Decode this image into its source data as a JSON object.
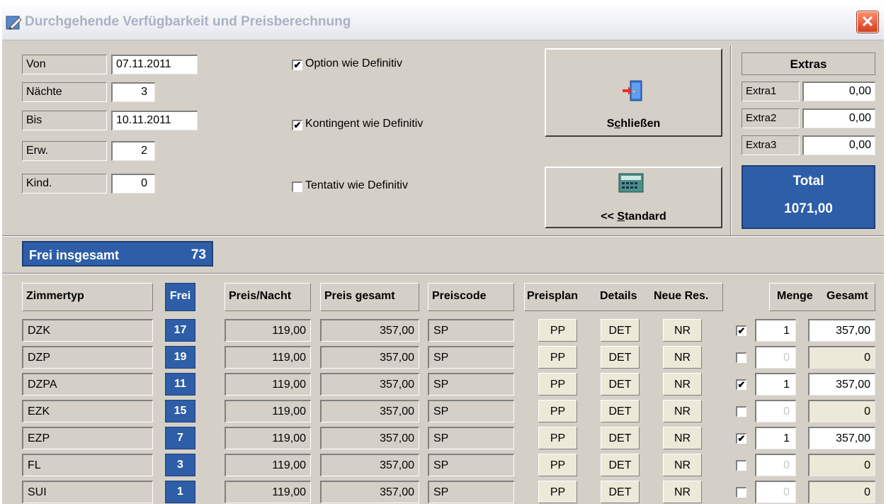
{
  "window": {
    "title": "Durchgehende Verfügbarkeit und Preisberechnung",
    "close_glyph": "✕"
  },
  "form": {
    "von_label": "Von",
    "von_value": "07.11.2011",
    "naechte_label": "Nächte",
    "naechte_value": "3",
    "bis_label": "Bis",
    "bis_value": "10.11.2011",
    "erw_label": "Erw.",
    "erw_value": "2",
    "kind_label": "Kind.",
    "kind_value": "0"
  },
  "options": [
    {
      "label": "Option wie Definitiv",
      "checked": true,
      "mark": "✔"
    },
    {
      "label": "Kontingent wie Definitiv",
      "checked": true,
      "mark": "✔"
    },
    {
      "label": "Tentativ wie Definitiv",
      "checked": false,
      "mark": ""
    }
  ],
  "buttons": {
    "close_prefix": "S",
    "close_mnemonic": "c",
    "close_suffix": "hließen",
    "standard_prefix": "<< ",
    "standard_mnemonic": "S",
    "standard_suffix": "tandard"
  },
  "icons": {
    "close": "door-exit-icon",
    "standard": "calculator-icon",
    "title": "pencil-icon"
  },
  "extras": {
    "header": "Extras",
    "items": [
      {
        "label": "Extra1",
        "value": "0,00"
      },
      {
        "label": "Extra2",
        "value": "0,00"
      },
      {
        "label": "Extra3",
        "value": "0,00"
      }
    ],
    "total_label": "Total",
    "total_value": "1071,00"
  },
  "frei_insgesamt": {
    "label": "Frei insgesamt",
    "value": "73"
  },
  "table": {
    "headers": {
      "zimmertyp": "Zimmertyp",
      "frei": "Frei",
      "preis_nacht": "Preis/Nacht",
      "preis_gesamt": "Preis gesamt",
      "preiscode": "Preiscode",
      "preisplan": "Preisplan",
      "details": "Details",
      "neue_res": "Neue Res.",
      "menge": "Menge",
      "gesamt": "Gesamt"
    },
    "rows": [
      {
        "zimmertyp": "DZK",
        "frei": "17",
        "preis_nacht": "119,00",
        "preis_gesamt": "357,00",
        "preiscode": "SP",
        "pp": "PP",
        "det": "DET",
        "nr": "NR",
        "checked": true,
        "mark": "✔",
        "menge": "1",
        "gesamt": "357,00"
      },
      {
        "zimmertyp": "DZP",
        "frei": "19",
        "preis_nacht": "119,00",
        "preis_gesamt": "357,00",
        "preiscode": "SP",
        "pp": "PP",
        "det": "DET",
        "nr": "NR",
        "checked": false,
        "mark": "",
        "menge": "0",
        "gesamt": "0"
      },
      {
        "zimmertyp": "DZPA",
        "frei": "11",
        "preis_nacht": "119,00",
        "preis_gesamt": "357,00",
        "preiscode": "SP",
        "pp": "PP",
        "det": "DET",
        "nr": "NR",
        "checked": true,
        "mark": "✔",
        "menge": "1",
        "gesamt": "357,00"
      },
      {
        "zimmertyp": "EZK",
        "frei": "15",
        "preis_nacht": "119,00",
        "preis_gesamt": "357,00",
        "preiscode": "SP",
        "pp": "PP",
        "det": "DET",
        "nr": "NR",
        "checked": false,
        "mark": "",
        "menge": "0",
        "gesamt": "0"
      },
      {
        "zimmertyp": "EZP",
        "frei": "7",
        "preis_nacht": "119,00",
        "preis_gesamt": "357,00",
        "preiscode": "SP",
        "pp": "PP",
        "det": "DET",
        "nr": "NR",
        "checked": true,
        "mark": "✔",
        "menge": "1",
        "gesamt": "357,00"
      },
      {
        "zimmertyp": "FL",
        "frei": "3",
        "preis_nacht": "119,00",
        "preis_gesamt": "357,00",
        "preiscode": "SP",
        "pp": "PP",
        "det": "DET",
        "nr": "NR",
        "checked": false,
        "mark": "",
        "menge": "0",
        "gesamt": "0"
      },
      {
        "zimmertyp": "SUI",
        "frei": "1",
        "preis_nacht": "119,00",
        "preis_gesamt": "357,00",
        "preiscode": "SP",
        "pp": "PP",
        "det": "DET",
        "nr": "NR",
        "checked": false,
        "mark": "",
        "menge": "0",
        "gesamt": "0"
      }
    ]
  }
}
